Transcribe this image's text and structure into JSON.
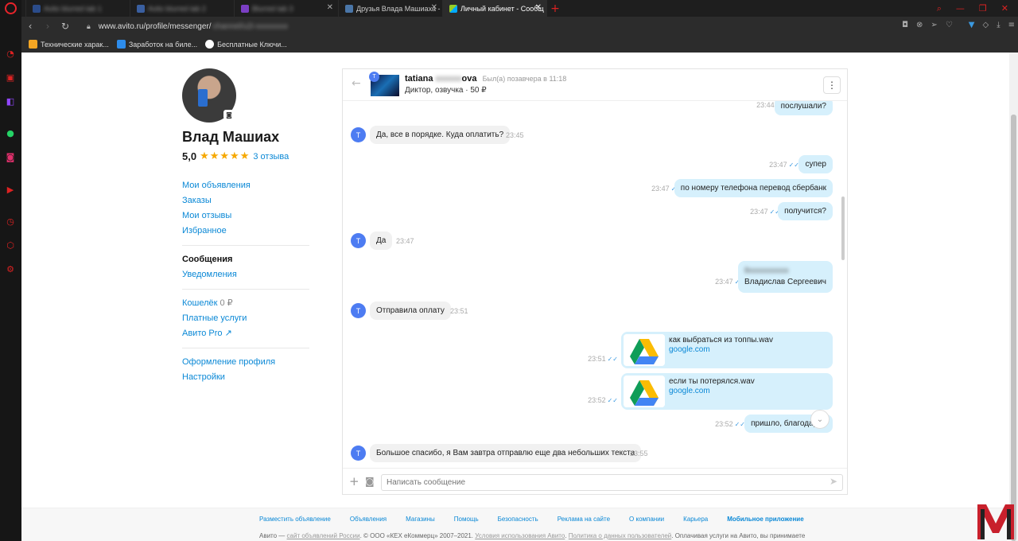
{
  "browser": {
    "tabs": [
      {
        "label": "Avito blurred tab 1",
        "blurred": true,
        "color": "#2b4c8a"
      },
      {
        "label": "Avito blurred tab 2",
        "blurred": true,
        "color": "#3a5fa0"
      },
      {
        "label": "Blurred tab 3",
        "blurred": true,
        "color": "#7b3fc4"
      },
      {
        "label": "Друзья Влада Машиаха -",
        "blurred": false,
        "color": "#4a76a8"
      },
      {
        "label": "Личный кабинет - Сообщ",
        "blurred": false,
        "color": "#97cf26"
      }
    ],
    "url_visible": "www.avito.ru/profile/messenger/",
    "url_hidden": "channel/u2i-xxxxxxxx",
    "bookmarks": [
      {
        "label": "Технические харак...",
        "color": "#f5a623"
      },
      {
        "label": "Заработок на биле...",
        "color": "#2d8ceb"
      },
      {
        "label": "Бесплатные Ключи...",
        "color": "#ffffff"
      }
    ]
  },
  "profile": {
    "name": "Влад Машиах",
    "rating": "5,0",
    "stars": "★★★★★",
    "reviews_link": "3 отзыва",
    "menu1": [
      "Мои объявления",
      "Заказы",
      "Мои отзывы",
      "Избранное"
    ],
    "menu2_active": "Сообщения",
    "menu2": [
      "Уведомления"
    ],
    "wallet_label": "Кошелёк",
    "wallet_value": "0 ₽",
    "paid_services": "Платные услуги",
    "avito_pro": "Авито Pro ↗",
    "menu4": [
      "Оформление профиля",
      "Настройки"
    ]
  },
  "chat": {
    "contact_first": "tatiana",
    "contact_hidden": "xxxxxx",
    "contact_last": "ova",
    "status": "Был(а) позавчера в 11:18",
    "item": "Диктор, озвучка · 50 ₽",
    "avatar_letter": "T",
    "messages": {
      "m1_text": "послушали?",
      "m1_time": "23:44",
      "m2_text": "Да, все в порядке. Куда оплатить?",
      "m2_time": "23:45",
      "m3_text": "супер",
      "m3_time": "23:47",
      "m4_text": "по номеру телефона перевод сбербанк",
      "m4_time": "23:47",
      "m5_text": "получится?",
      "m5_time": "23:47",
      "m6_text": "Да",
      "m6_time": "23:47",
      "m7_hidden": "8xxxxxxxxxx",
      "m7_line2": "Владислав Сергеевич",
      "m7_time": "23:47",
      "m8_text": "Отправила оплату",
      "m8_time": "23:51",
      "f1_name": "как выбраться из топпы.wav",
      "f1_link": "google.com",
      "f1_time": "23:51",
      "f2_name": "если ты потерялся.wav",
      "f2_link": "google.com",
      "f2_time": "23:52",
      "m9_text": "пришло, благодарю)",
      "m9_time": "23:52",
      "m10_text": "Большое спасибо, я Вам завтра отправлю  еще два небольших текста",
      "m10_time": "23:55"
    },
    "composer_placeholder": "Написать сообщение"
  },
  "footer": {
    "links": [
      "Разместить объявление",
      "Объявления",
      "Магазины",
      "Помощь",
      "Безопасность",
      "Реклама на сайте",
      "О компании",
      "Карьера"
    ],
    "mobile_app": "Мобильное приложение",
    "copy_start": "Авито — ",
    "copy_link1": "сайт объявлений России",
    "copy_mid": ". © ООО «КЕХ еКоммерц» 2007–2021. ",
    "copy_link2": "Условия использования Авито",
    "copy_sep": ". ",
    "copy_link3": "Политика о данных пользователей",
    "copy_end": ". Оплачивая услуги на Авито, вы принимаете"
  },
  "colors": {
    "accent": "#0a88d6",
    "bubble_out": "#d6f0fc",
    "bubble_in": "#f1f1f1",
    "star": "#f6a800",
    "opera_red": "#e8242b"
  }
}
